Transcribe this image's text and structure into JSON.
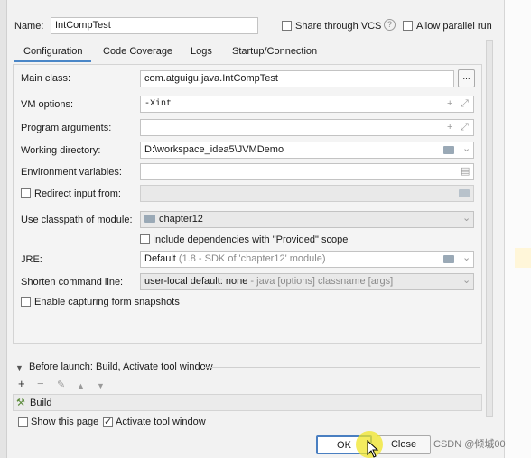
{
  "name_label": "Name:",
  "name_value": "IntCompTest",
  "share_vcs_label": "Share through VCS",
  "help_icon": "?",
  "allow_parallel_label": "Allow parallel run",
  "tabs": [
    "Configuration",
    "Code Coverage",
    "Logs",
    "Startup/Connection"
  ],
  "form": {
    "main_class_label": "Main class:",
    "main_class_value": "com.atguigu.java.IntCompTest",
    "browse_label": "...",
    "vm_options_label": "VM options:",
    "vm_options_value": "-Xint",
    "program_args_label": "Program arguments:",
    "working_dir_label": "Working directory:",
    "working_dir_value": "D:\\workspace_idea5\\JVMDemo",
    "env_vars_label": "Environment variables:",
    "redirect_label": "Redirect input from:",
    "classpath_label": "Use classpath of module:",
    "classpath_value": "chapter12",
    "include_deps_label": "Include dependencies with \"Provided\" scope",
    "jre_label": "JRE:",
    "jre_default": "Default",
    "jre_hint": "(1.8 - SDK of 'chapter12' module)",
    "shorten_label": "Shorten command line:",
    "shorten_value": "user-local default: none",
    "shorten_hint": "- java [options] classname [args]",
    "snapshots_label": "Enable capturing form snapshots"
  },
  "before_launch": {
    "title": "Before launch: Build, Activate tool window",
    "build_item": "Build",
    "show_page_label": "Show this page",
    "activate_label": "Activate tool window"
  },
  "buttons": {
    "ok": "OK",
    "close": "Close"
  },
  "watermark": "CSDN @倾城00",
  "colors": {
    "accent": "#4a86c7",
    "field_bg": "#ffffff",
    "disabled_bg": "#e9e9e9"
  }
}
